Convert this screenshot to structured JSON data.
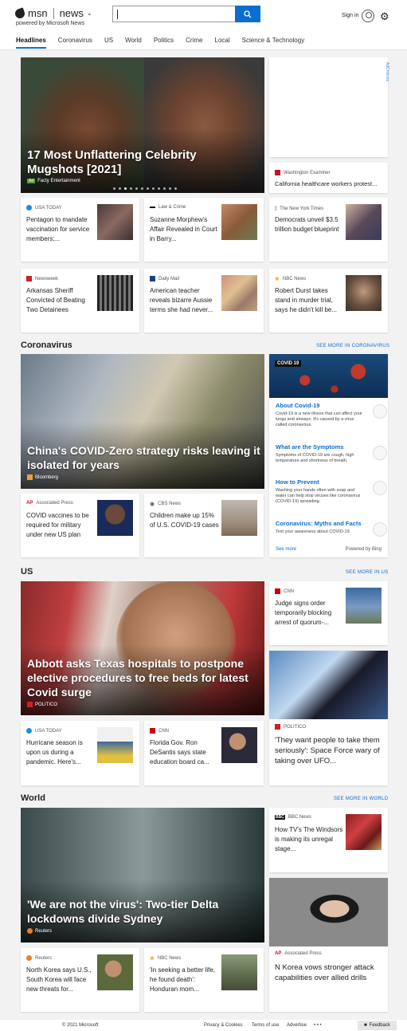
{
  "header": {
    "brand": "msn",
    "product": "news",
    "powered": "powered by Microsoft News",
    "signin": "Sign in"
  },
  "nav": [
    "Headlines",
    "Coronavirus",
    "US",
    "World",
    "Politics",
    "Crime",
    "Local",
    "Science & Technology"
  ],
  "hero1": {
    "title": "17 Most Unflattering Celebrity Mugshots [2021]",
    "ad": "Ad",
    "source": "Facty Entertainment"
  },
  "adchoices": "AdChoices",
  "we": {
    "source": "Washington Examiner",
    "headline": "California healthcare workers protest..."
  },
  "row1": [
    {
      "source": "USA TODAY",
      "headline": "Pentagon to mandate vaccination for service members;...",
      "color": "#1a8de0"
    },
    {
      "source": "Law & Crime",
      "headline": "Suzanne Morphew's Affair Revealed in Court in Barry...",
      "color": "#111"
    },
    {
      "source": "The New York Times",
      "headline": "Democrats unveil $3.5 trillion budget blueprint",
      "color": "#111"
    }
  ],
  "row2": [
    {
      "source": "Newsweek",
      "headline": "Arkansas Sheriff Convicted of Beating Two Detainees",
      "color": "#d01f25"
    },
    {
      "source": "Daily Mail",
      "headline": "American teacher reveals bizarre Aussie terms she had never...",
      "color": "#1b3f8f"
    },
    {
      "source": "NBC News",
      "headline": "Robert Durst takes stand in murder trial, says he didn't kill be...",
      "color": "#e8a20c"
    }
  ],
  "coronavirus": {
    "title": "Coronavirus",
    "more": "SEE MORE IN CORONAVIRUS",
    "hero": {
      "title": "China's COVID-Zero strategy risks leaving it isolated for years",
      "source": "Bloomberg"
    },
    "stories": [
      {
        "source": "Associated Press",
        "headline": "COVID vaccines to be required for military under new US plan"
      },
      {
        "source": "CBS News",
        "headline": "Children make up 15% of U.S. COVID-19 cases"
      }
    ],
    "panel": {
      "badge": "COVID 19",
      "items": [
        {
          "title": "About Covid-19",
          "desc": "Covid-19 is a new illness that can affect your lungs and airways. It's caused by a virus called coronavirus."
        },
        {
          "title": "What are the Symptoms",
          "desc": "Symptoms of COVID-19 are cough, high temperature and shortness of breath."
        },
        {
          "title": "How to Prevent",
          "desc": "Washing your hands often with soap and water can help stop viruses like coronavirus (COVID-19) spreading."
        },
        {
          "title": "Coronavirus: Myths and Facts",
          "desc": "Test your awareness about COVID-19."
        }
      ],
      "see_more": "See more",
      "powered": "Powered by Bing"
    }
  },
  "us": {
    "title": "US",
    "more": "SEE MORE IN US",
    "hero": {
      "title": "Abbott asks Texas hospitals to postpone elective procedures to free beds for latest Covid surge",
      "source": "POLITICO"
    },
    "side": {
      "source": "CNN",
      "headline": "Judge signs order temporarily blocking arrest of quorum-..."
    },
    "side2": {
      "source": "POLITICO",
      "headline": "'They want people to take them seriously': Space Force wary of taking over UFO..."
    },
    "stories": [
      {
        "source": "USA TODAY",
        "headline": "Hurricane season is upon us during a pandemic. Here's..."
      },
      {
        "source": "CNN",
        "headline": "Florida Gov. Ron DeSantis says state education board ca..."
      }
    ]
  },
  "world": {
    "title": "World",
    "more": "SEE MORE IN WORLD",
    "hero": {
      "title": "'We are not the virus': Two-tier Delta lockdowns divide Sydney",
      "source": "Reuters"
    },
    "side": {
      "source": "BBC News",
      "headline": "How TV's The Windsors is making its unregal stage..."
    },
    "side2": {
      "source": "Associated Press",
      "headline": "N Korea vows stronger attack capabilities over allied drills"
    },
    "stories": [
      {
        "source": "Reuters",
        "headline": "North Korea says U.S., South Korea will face new threats for..."
      },
      {
        "source": "NBC News",
        "headline": "'In seeking a better life, he found death': Honduran mom..."
      }
    ]
  },
  "footer": {
    "copyright": "© 2021 Microsoft",
    "privacy": "Privacy & Cookies",
    "terms": "Terms of use",
    "advertise": "Advertise",
    "dots": "• • •",
    "feedback": "Feedback"
  }
}
